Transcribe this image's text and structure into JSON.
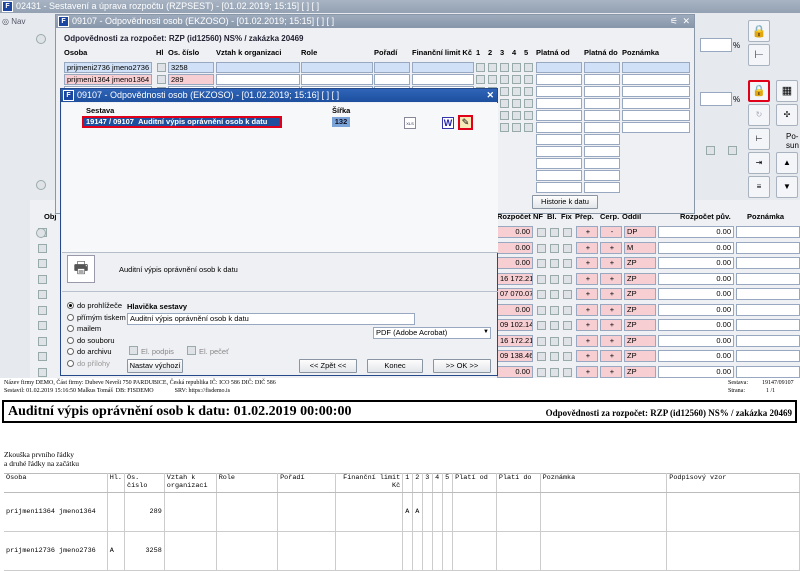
{
  "main_window": {
    "title": "02431 - Sestavení a úprava rozpočtu (RZPSEST) - [01.02.2019; 15:15] [ ] [ ]",
    "nav_label": "Nav"
  },
  "inner_window": {
    "title": "09107 - Odpovědnosti osob (EKZOSO) - [01.02.2019; 15:15] [ ] [ ]",
    "subtitle": "Odpovědnosti za rozpočet: RZP (id12560) NS% / zakázka 20469",
    "columns": [
      "Osoba",
      "Hl",
      "Os. číslo",
      "Vztah k organizaci",
      "Role",
      "Pořadí",
      "Finanční limit Kč",
      "1",
      "2",
      "3",
      "4",
      "5",
      "Platná od",
      "Platná do",
      "Poznámka"
    ],
    "rows": [
      {
        "osoba": "prijmeni2736 jmeno2736",
        "os_cislo": "3258"
      },
      {
        "osoba": "prijmeni1364 jmeno1364",
        "os_cislo": "289"
      }
    ],
    "historie_button": "Historie k datu"
  },
  "bg_grid": {
    "columns": [
      "Obj",
      "Rozpočet",
      "NF",
      "Bl.",
      "Fix",
      "Přep.",
      "Cerp.",
      "Oddíl",
      "Rozpočet pův.",
      "Poznámka"
    ],
    "rows": [
      {
        "rozpocet": "0.00",
        "oddil": "DP",
        "puv": "0.00"
      },
      {
        "rozpocet": "0.00",
        "oddil": "M",
        "puv": "0.00"
      },
      {
        "rozpocet": "0.00",
        "oddil": "ZP",
        "puv": "0.00"
      },
      {
        "rozpocet": "16 172.21",
        "oddil": "ZP",
        "puv": "0.00"
      },
      {
        "rozpocet": "07 070.07",
        "oddil": "ZP",
        "puv": "0.00"
      },
      {
        "rozpocet": "0.00",
        "oddil": "ZP",
        "puv": "0.00"
      },
      {
        "rozpocet": "09 102.14",
        "oddil": "ZP",
        "puv": "0.00"
      },
      {
        "rozpocet": "16 172.21",
        "oddil": "ZP",
        "puv": "0.00"
      },
      {
        "rozpocet": "09 138.46",
        "oddil": "ZP",
        "puv": "0.00"
      },
      {
        "rozpocet": "0.00",
        "oddil": "ZP",
        "puv": "0.00"
      },
      {
        "rozpocet": "0.00",
        "oddil": "ZP",
        "puv": "0.00"
      }
    ],
    "plus": "+",
    "minus": "-"
  },
  "right_panel": {
    "percent": "%",
    "po_label": "Po-",
    "sun_label": "sun"
  },
  "dialog": {
    "title": "09107 - Odpovědnosti osob (EKZOSO) - [01.02.2019; 15:16] [ ] [ ]",
    "col_sestava": "Sestava",
    "col_sirka": "Šířka",
    "selected_code": "19147 / 09107",
    "selected_name": "Auditní výpis oprávnění osob k datu",
    "selected_width": "132",
    "desc": "Auditní výpis oprávnění osob k datu",
    "output_options": [
      "do prohlížeče",
      "přímým tiskem",
      "mailem",
      "do souboru",
      "do archivu",
      "do přílohy"
    ],
    "header_label": "Hlavička sestavy",
    "header_value": "Auditní výpis oprávnění osob k datu",
    "format": "PDF (Adobe Acrobat)",
    "el_podpis": "El. podpis",
    "el_pecet": "El. pečeť",
    "btn_nastav": "Nastav výchozí",
    "btn_zpet": "<< Zpět <<",
    "btn_konec": "Konec",
    "btn_ok": ">> OK >>",
    "xls_label": "XLS"
  },
  "report": {
    "company_line1": "Název firmy DEMO, Část firmy: Dubeve Nevrši 750 PARDUBICE, Česká republika  IČ: ICO 586  DIČ: DIČ 586",
    "company_line2": "Sestavil: 01.02.2019 15:16:50 Malkus Tomáš  DB: FISDEMO              SRV: https://fisdemo.is",
    "sestava_label": "Sestava:",
    "sestava_value": "19147/09107",
    "strana_label": "Strana:",
    "strana_value": "1 /1",
    "title": "Auditní výpis oprávnění osob k datu: 01.02.2019 00:00:00",
    "title_right": "Odpovědnosti za rozpočet: RZP (id12560) NS% / zakázka 20469",
    "note_line1": "Zkouška prvního řádky",
    "note_line2": "a druhé řádky na začátku",
    "columns": [
      "Osoba",
      "Hl.",
      "Os. číslo",
      "Vztah k organizaci",
      "Role",
      "Pořadí",
      "Finanční limit Kč",
      "1",
      "2",
      "3",
      "4",
      "5",
      "Platí od",
      "Platí do",
      "Poznámka",
      "Podpisový vzor"
    ],
    "rows": [
      {
        "osoba": "prijmeni1364 jmeno1364",
        "hl": "",
        "os_cislo": "289",
        "c1": "A",
        "c2": "A"
      },
      {
        "osoba": "prijmeni2736 jmeno2736",
        "hl": "A",
        "os_cislo": "3258",
        "c1": "",
        "c2": ""
      }
    ]
  },
  "colors": {
    "title_active": "#2f64b8",
    "title_inactive": "#8f9db0",
    "selection": "#1d4f9e",
    "highlight_red": "#e0001a",
    "pink_cell": "#f7cfd3"
  }
}
